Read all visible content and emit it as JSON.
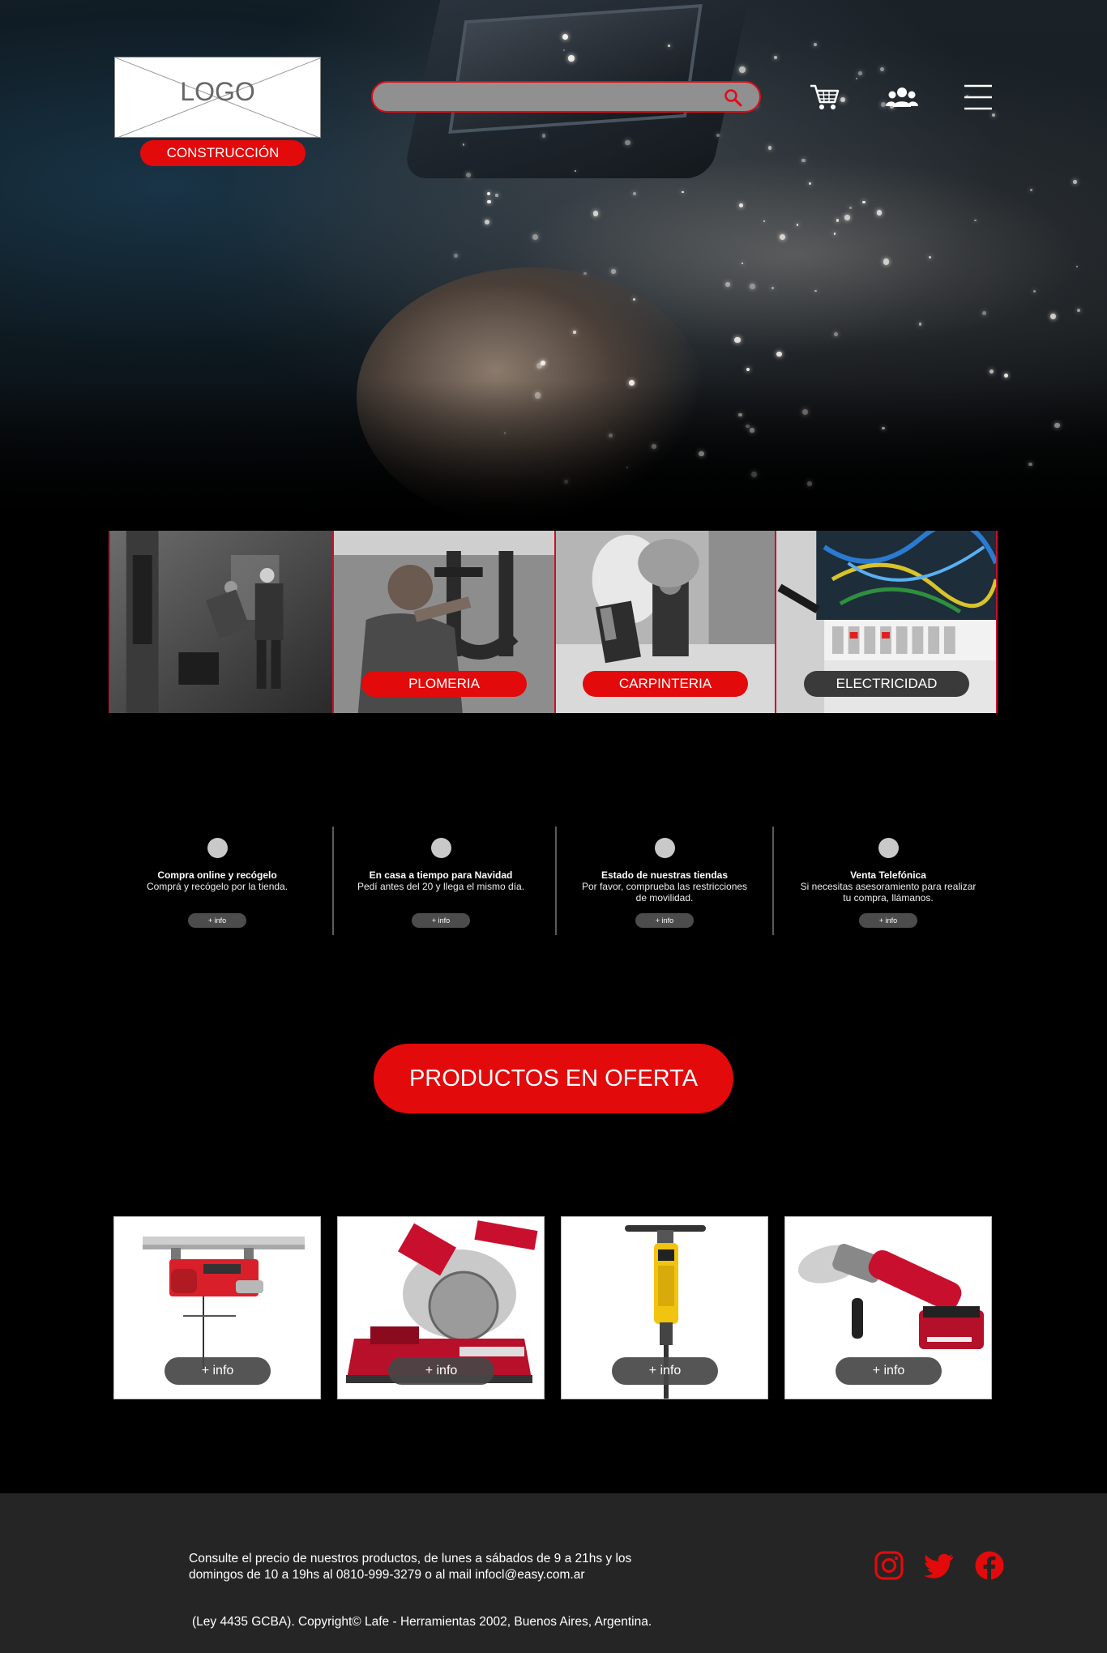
{
  "header": {
    "logo_text": "LOGO",
    "search_placeholder": "",
    "icons": [
      "cart-icon",
      "users-icon",
      "menu-icon"
    ]
  },
  "categories": [
    {
      "label": "CONSTRUCCIÓN",
      "pill_color": "#e20a0a"
    },
    {
      "label": "PLOMERIA",
      "pill_color": "#e20a0a"
    },
    {
      "label": "CARPINTERIA",
      "pill_color": "#e20a0a"
    },
    {
      "label": "ELECTRICIDAD",
      "pill_color": "#3a3a3a"
    }
  ],
  "info_items": [
    {
      "title": "Compra online y recógelo",
      "desc": "Comprá y recógelo por la tienda.",
      "button": "+ info"
    },
    {
      "title": "En casa a tiempo para Navidad",
      "desc": "Pedí antes del 20 y llega el mismo día.",
      "button": "+ info"
    },
    {
      "title": "Estado de nuestras tiendas",
      "desc": "Por favor, comprueba las restricciones de movilidad.",
      "button": "+ info"
    },
    {
      "title": "Venta Telefónica",
      "desc": "Si necesitas asesoramiento para realizar tu compra, llámanos.",
      "button": "+ info"
    }
  ],
  "offer": {
    "label": "PRODUCTOS EN OFERTA"
  },
  "products": [
    {
      "name": "electric-hoist",
      "button": "+ info"
    },
    {
      "name": "miter-saw",
      "button": "+ info"
    },
    {
      "name": "demolition-hammer",
      "button": "+ info"
    },
    {
      "name": "angle-grinder",
      "button": "+ info"
    }
  ],
  "footer": {
    "contact_line1": "Consulte el precio de nuestros productos, de lunes a sábados de 9 a 21hs y los",
    "contact_line2": "domingos de 10 a 19hs al 0810-999-3279 o al mail infocl@easy.com.ar",
    "copyright": "(Ley 4435 GCBA). Copyright© Lafe - Herramientas 2002, Buenos Aires, Argentina.",
    "social": [
      "instagram-icon",
      "twitter-icon",
      "facebook-icon"
    ]
  },
  "colors": {
    "accent": "#e20a0a",
    "background": "#000000",
    "footer": "#252525"
  }
}
